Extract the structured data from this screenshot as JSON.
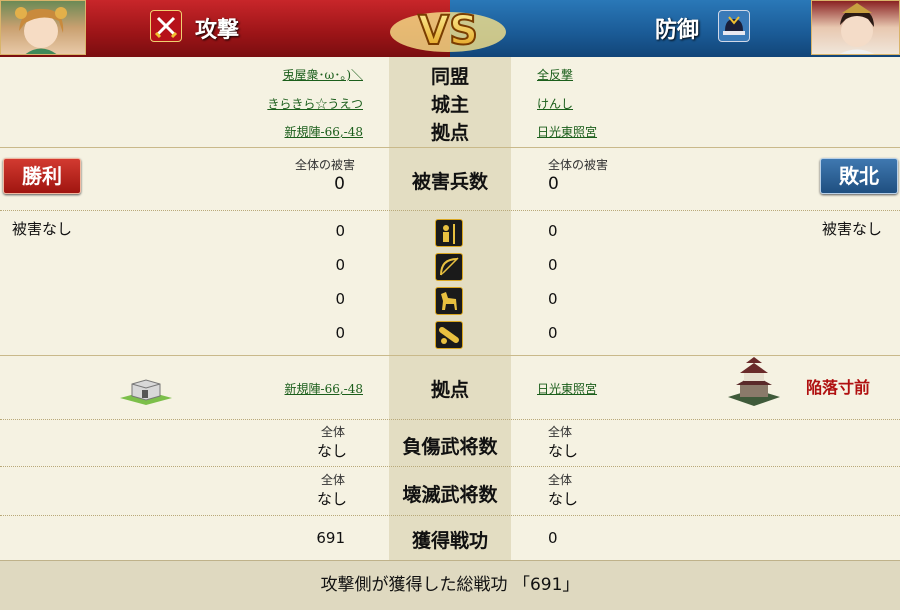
{
  "header": {
    "attack_label": "攻撃",
    "defense_label": "防御",
    "vs_text": "VS"
  },
  "info": {
    "alliance_label": "同盟",
    "lord_label": "城主",
    "base_label": "拠点",
    "attacker": {
      "alliance": "兎屋衆･ω･｡)＼",
      "lord": "きらきら☆うえつ",
      "base": "新規陣-66,-48"
    },
    "defender": {
      "alliance": "全反撃",
      "lord": "けんし",
      "base": "日光東照宮"
    }
  },
  "result": {
    "attacker_badge": "勝利",
    "defender_badge": "敗北",
    "casualties_label": "被害兵数",
    "total_label": "全体の被害",
    "attacker_total": "0",
    "defender_total": "0",
    "attacker_note": "被害なし",
    "defender_note": "被害なし"
  },
  "units": [
    {
      "icon": "spearman-icon",
      "attacker": "0",
      "defender": "0"
    },
    {
      "icon": "archer-bow-icon",
      "attacker": "0",
      "defender": "0"
    },
    {
      "icon": "cavalry-horse-icon",
      "attacker": "0",
      "defender": "0"
    },
    {
      "icon": "siege-cannon-icon",
      "attacker": "0",
      "defender": "0"
    }
  ],
  "base_row": {
    "label": "拠点",
    "attacker_base": "新規陣-66,-48",
    "defender_base": "日光東照宮",
    "defender_status": "陥落寸前"
  },
  "generals": {
    "wounded_label": "負傷武将数",
    "destroyed_label": "壊滅武将数",
    "whole_label": "全体",
    "attacker_wounded": "なし",
    "defender_wounded": "なし",
    "attacker_destroyed": "なし",
    "defender_destroyed": "なし"
  },
  "merit": {
    "label": "獲得戦功",
    "attacker": "691",
    "defender": "0"
  },
  "footer": {
    "text": "攻撃側が獲得した総戦功 「691」"
  },
  "colors": {
    "attack_red": "#b01f22",
    "defense_blue": "#1d5f9b",
    "link_green": "#1b5e1b"
  }
}
